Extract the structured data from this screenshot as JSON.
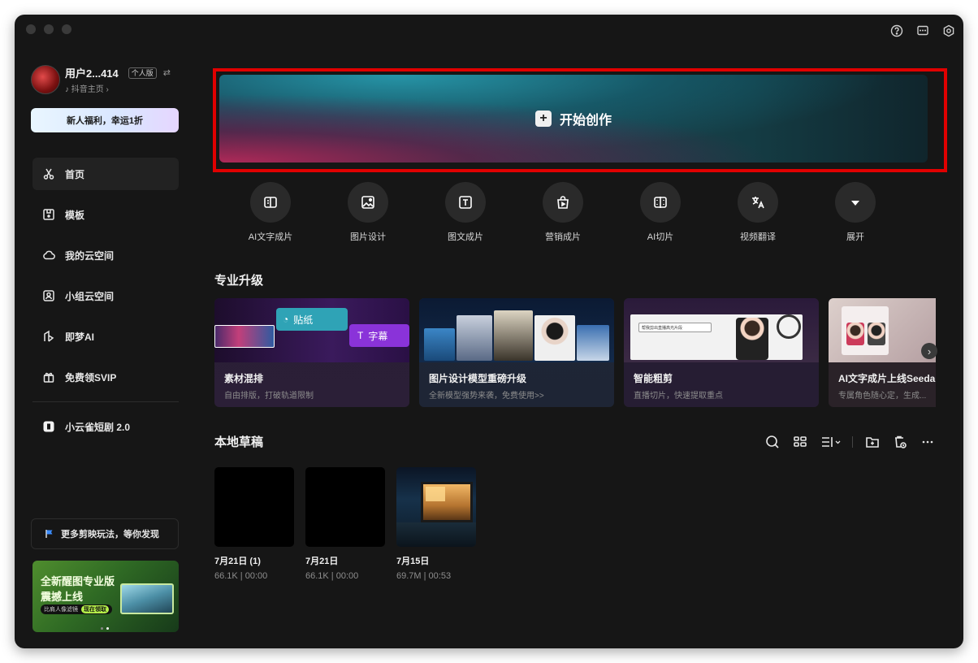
{
  "window": {
    "top_icons": [
      "help-icon",
      "feedback-icon",
      "settings-icon"
    ]
  },
  "user": {
    "name": "用户2...414",
    "plan_badge": "个人版",
    "swap_glyph": "⇄",
    "douyin_link": "抖音主页",
    "promo_button": "新人福利，幸运1折"
  },
  "sidebar": {
    "items": [
      {
        "label": "首页",
        "icon": "scissors-icon",
        "active": true
      },
      {
        "label": "模板",
        "icon": "template-icon",
        "active": false
      },
      {
        "label": "我的云空间",
        "icon": "cloud-icon",
        "active": false
      },
      {
        "label": "小组云空间",
        "icon": "group-cloud-icon",
        "active": false
      },
      {
        "label": "即梦AI",
        "icon": "jimeng-icon",
        "active": false
      },
      {
        "label": "免费领SVIP",
        "icon": "gift-icon",
        "active": false
      }
    ],
    "extra_item": {
      "label": "小云雀短剧 2.0",
      "icon": "xiaoyunque-icon"
    },
    "more_box": "更多剪映玩法，等你发现",
    "ad": {
      "line1": "全新醒图专业版",
      "line2": "震撼上线",
      "pill_text": "比肩人像滤镜",
      "pill_cta": "现在领取"
    }
  },
  "hero": {
    "label": "开始创作"
  },
  "tools": [
    {
      "label": "AI文字成片",
      "icon": "ai-text-video-icon"
    },
    {
      "label": "图片设计",
      "icon": "image-design-icon"
    },
    {
      "label": "图文成片",
      "icon": "text-image-video-icon"
    },
    {
      "label": "营销成片",
      "icon": "marketing-bag-icon"
    },
    {
      "label": "AI切片",
      "icon": "ai-slice-icon"
    },
    {
      "label": "视频翻译",
      "icon": "translate-icon"
    },
    {
      "label": "展开",
      "icon": "expand-down-icon"
    }
  ],
  "pro_section": {
    "title": "专业升级",
    "cards": [
      {
        "title": "素材混排",
        "subtitle": "自由排版，打破轨道限制",
        "sticker": "贴纸",
        "caption": "字幕"
      },
      {
        "title": "图片设计模型重磅升级",
        "subtitle": "全新模型强势来袭，免费使用>>"
      },
      {
        "title": "智能粗剪",
        "subtitle": "直播切片，快速提取重点",
        "screen_text": "帮我剪出直播高光片段"
      },
      {
        "title": "AI文字成片上线Seedance",
        "subtitle": "专属角色随心定，生成..."
      }
    ]
  },
  "drafts_section": {
    "title": "本地草稿",
    "drafts": [
      {
        "name": "7月21日 (1)",
        "meta": "66.1K | 00:00",
        "thumb": "black"
      },
      {
        "name": "7月21日",
        "meta": "66.1K | 00:00",
        "thumb": "black"
      },
      {
        "name": "7月15日",
        "meta": "69.7M | 00:53",
        "thumb": "night-shop"
      }
    ]
  }
}
